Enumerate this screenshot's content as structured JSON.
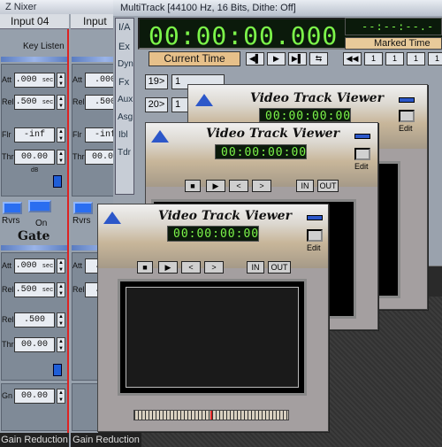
{
  "mixer": {
    "title": "Z Nixer",
    "channels": [
      {
        "name": "Input 04"
      },
      {
        "name": "Input"
      }
    ],
    "labels": {
      "att": "Att",
      "rel": "Rel",
      "flr": "Flr",
      "thr": "Thr",
      "gn": "Gn"
    },
    "upper": {
      "att": ".000",
      "rel": ".500",
      "flr": "-inf",
      "thr": "00.00"
    },
    "lower": {
      "att": ".000",
      "rel": ".500",
      "rel2": ".500",
      "thr": "00.00",
      "gn": "00.00"
    },
    "unit_sec": "sec",
    "unit_db": "dB",
    "rvrs": "Rvrs",
    "on": "On",
    "gate": "Gate",
    "key_listen": "Key Listen",
    "gain_reduction": "Gain Reduction"
  },
  "multitrack": {
    "title": "MultiTrack  [44100 Hz, 16 Bits, Dithe: Off]",
    "time": "00:00:00.000",
    "current_time": "Current Time",
    "marked_time": "Marked Time",
    "marked_display": "--:--:--.---",
    "side_labels": [
      "I/A",
      "Ex",
      "Dyn",
      "Fx",
      "Aux",
      "Asg",
      "Ibl",
      "Tdr"
    ],
    "tracks": [
      "19>",
      "20>"
    ],
    "rows": [
      "1",
      "1"
    ]
  },
  "viewers": [
    {
      "title": "Video Track Viewer",
      "time": "00:00:00:00",
      "edit": "Edit"
    },
    {
      "title": "Video Track Viewer",
      "time": "00:00:00:00",
      "edit": "Edit"
    },
    {
      "title": "Video Track Viewer",
      "time": "00:00:00:00",
      "edit": "Edit"
    }
  ],
  "viewer_controls": {
    "in": "IN",
    "out": "OUT"
  }
}
